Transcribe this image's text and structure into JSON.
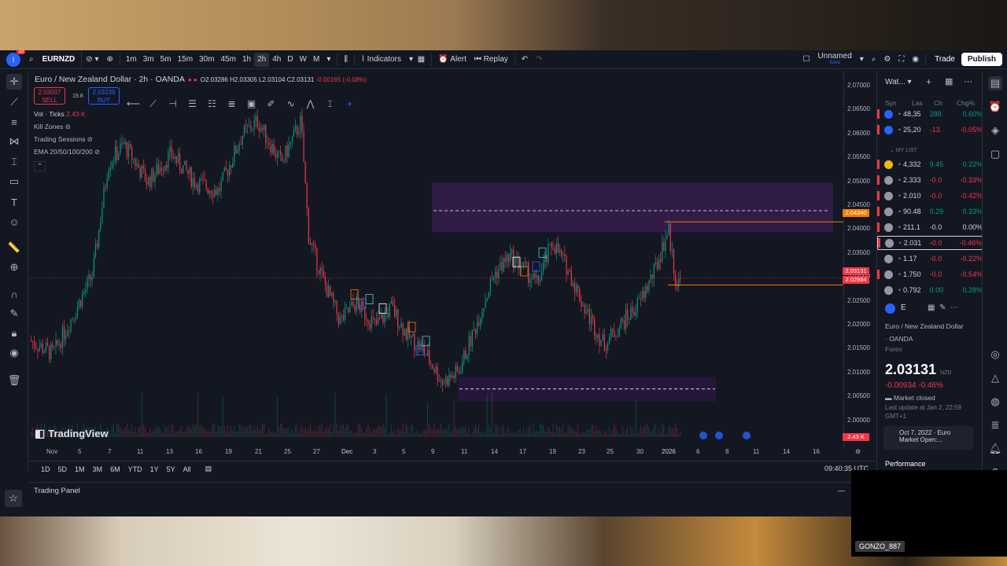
{
  "header": {
    "symbol": "EURNZD",
    "intervals": [
      "1m",
      "3m",
      "5m",
      "15m",
      "30m",
      "45m",
      "1h",
      "2h",
      "4h",
      "D",
      "W",
      "M"
    ],
    "active_interval": "2h",
    "indicators_label": "Indicators",
    "alert_label": "Alert",
    "replay_label": "Replay",
    "layout_name": "Unnamed",
    "layout_sub": "Save",
    "trade_label": "Trade",
    "publish_label": "Publish",
    "notif_count": "10"
  },
  "legend": {
    "title": "Euro / New Zealand Dollar · 2h · OANDA",
    "open": "O2.03286",
    "high": "H2.03305",
    "low": "L2.03104",
    "close": "C2.03131",
    "change": "-0.00165 (-0.08%)",
    "sell_price": "2.03037",
    "sell_label": "SELL",
    "buy_price": "2.03239",
    "buy_label": "BUY",
    "spread": "19.8",
    "vol_label": "Vol · Ticks",
    "vol_value": "2.43 K",
    "ind_kill": "Kill Zones",
    "ind_sessions": "Trading Sessions",
    "ind_ema": "EMA 20/50/100/200"
  },
  "price_axis": [
    "2.07000",
    "2.06500",
    "2.06000",
    "2.05500",
    "2.05000",
    "2.04500",
    "2.04000",
    "2.03500",
    "2.03000",
    "2.02500",
    "2.02000",
    "2.01500",
    "2.01000",
    "2.00500",
    "2.00000"
  ],
  "price_tags": {
    "orange": "2.04340",
    "red1": "2.03131",
    "red2": "2.02984",
    "vol": "2.43 K"
  },
  "time_axis": [
    "Nov",
    "5",
    "7",
    "11",
    "13",
    "16",
    "19",
    "21",
    "25",
    "27",
    "Dec",
    "3",
    "5",
    "9",
    "11",
    "14",
    "17",
    "19",
    "23",
    "25",
    "30",
    "2026",
    "6",
    "8",
    "11",
    "14",
    "16"
  ],
  "ranges": [
    "1D",
    "5D",
    "1M",
    "3M",
    "6M",
    "YTD",
    "1Y",
    "5Y",
    "All"
  ],
  "clock": "09:40:35 UTC",
  "watermark": "TradingView",
  "trading_panel": "Trading Panel",
  "watchlist": {
    "title": "Wat...",
    "cols": [
      "Syn",
      "Las",
      "Ch",
      "Chg%"
    ],
    "section": "MY LIST",
    "rows": [
      {
        "last": "48,35",
        "ch": "288.",
        "chg": "0.60%",
        "dir": "pos",
        "bar": "#f23645",
        "icon": "#2962ff"
      },
      {
        "last": "25,20",
        "ch": "-13.",
        "chg": "-0.05%",
        "dir": "neg",
        "bar": "#f23645",
        "icon": "#2962ff"
      },
      {
        "last": "4,332",
        "ch": "9.45",
        "chg": "0.22%",
        "dir": "pos",
        "bar": "#f23645",
        "icon": "#f0b90b"
      },
      {
        "last": "2.333",
        "ch": "-0.0",
        "chg": "-0.33%",
        "dir": "neg",
        "bar": "#f23645",
        "icon": "#9598a1"
      },
      {
        "last": "2.010",
        "ch": "-0.0",
        "chg": "-0.42%",
        "dir": "neg",
        "bar": "#f23645",
        "icon": "#9598a1"
      },
      {
        "last": "90.48",
        "ch": "0.29",
        "chg": "0.33%",
        "dir": "pos",
        "bar": "#f23645",
        "icon": "#9598a1"
      },
      {
        "last": "211.1",
        "ch": "-0.0",
        "chg": "0.00%",
        "dir": "neutral",
        "bar": "#f23645",
        "icon": "#9598a1"
      },
      {
        "last": "2.031",
        "ch": "-0.0",
        "chg": "-0.46%",
        "dir": "neg",
        "bar": "#f23645",
        "icon": "#9598a1"
      },
      {
        "last": "1.17",
        "ch": "-0.0",
        "chg": "-0.22%",
        "dir": "neg",
        "bar": "#131722",
        "icon": "#9598a1"
      },
      {
        "last": "1.750",
        "ch": "-0.0",
        "chg": "-0.54%",
        "dir": "neg",
        "bar": "#f23645",
        "icon": "#9598a1"
      },
      {
        "last": "0.792",
        "ch": "0.00",
        "chg": "0.28%",
        "dir": "pos",
        "bar": "#131722",
        "icon": "#9598a1"
      }
    ]
  },
  "detail": {
    "short_sym": "E",
    "name": "Euro / New Zealand Dollar",
    "exchange": "· OANDA",
    "type": "Forex",
    "price": "2.03131",
    "currency": "NZD",
    "change": "-0.00934 -0.46%",
    "status": "Market closed",
    "updated": "Last update at Jan 2, 22:59",
    "tz": "GMT+1",
    "news": "Oct 7, 2022 · Euro Market Open:...",
    "performance": "Performance"
  },
  "streamer": "GONZO_887",
  "colors": {
    "up": "#089981",
    "down": "#f23645",
    "zone": "#3b1f54",
    "orange": "#f57c00"
  }
}
